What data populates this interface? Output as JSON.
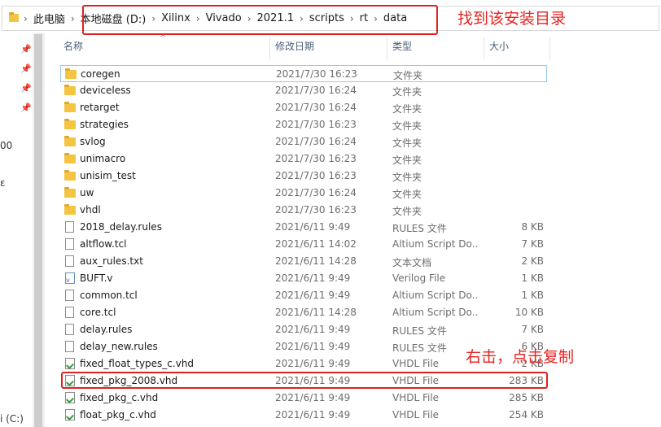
{
  "breadcrumb": [
    "此电脑",
    "本地磁盘 (D:)",
    "Xilinx",
    "Vivado",
    "2021.1",
    "scripts",
    "rt",
    "data"
  ],
  "annotations": {
    "top": "找到该安装目录",
    "row": "右击，点击复制"
  },
  "sidebar_edge": {
    "a": "00",
    "b": "ε",
    "c": "i (C:)"
  },
  "columns": {
    "name": "名称",
    "date": "修改日期",
    "type": "类型",
    "size": "大小"
  },
  "files": [
    {
      "name": "coregen",
      "date": "2021/7/30 16:23",
      "type": "文件夹",
      "size": "",
      "icon": "folder"
    },
    {
      "name": "deviceless",
      "date": "2021/7/30 16:24",
      "type": "文件夹",
      "size": "",
      "icon": "folder"
    },
    {
      "name": "retarget",
      "date": "2021/7/30 16:24",
      "type": "文件夹",
      "size": "",
      "icon": "folder"
    },
    {
      "name": "strategies",
      "date": "2021/7/30 16:23",
      "type": "文件夹",
      "size": "",
      "icon": "folder"
    },
    {
      "name": "svlog",
      "date": "2021/7/30 16:24",
      "type": "文件夹",
      "size": "",
      "icon": "folder"
    },
    {
      "name": "unimacro",
      "date": "2021/7/30 16:23",
      "type": "文件夹",
      "size": "",
      "icon": "folder"
    },
    {
      "name": "unisim_test",
      "date": "2021/7/30 16:23",
      "type": "文件夹",
      "size": "",
      "icon": "folder"
    },
    {
      "name": "uw",
      "date": "2021/7/30 16:24",
      "type": "文件夹",
      "size": "",
      "icon": "folder"
    },
    {
      "name": "vhdl",
      "date": "2021/7/30 16:23",
      "type": "文件夹",
      "size": "",
      "icon": "folder"
    },
    {
      "name": "2018_delay.rules",
      "date": "2021/6/11 9:49",
      "type": "RULES 文件",
      "size": "8 KB",
      "icon": "doc"
    },
    {
      "name": "altflow.tcl",
      "date": "2021/6/11 14:02",
      "type": "Altium Script Do...",
      "size": "7 KB",
      "icon": "doc"
    },
    {
      "name": "aux_rules.txt",
      "date": "2021/6/11 14:28",
      "type": "文本文档",
      "size": "2 KB",
      "icon": "doc"
    },
    {
      "name": "BUFT.v",
      "date": "2021/6/11 9:49",
      "type": "Verilog File",
      "size": "1 KB",
      "icon": "verilog"
    },
    {
      "name": "common.tcl",
      "date": "2021/6/11 9:49",
      "type": "Altium Script Do...",
      "size": "1 KB",
      "icon": "doc"
    },
    {
      "name": "core.tcl",
      "date": "2021/6/11 14:28",
      "type": "Altium Script Do...",
      "size": "10 KB",
      "icon": "doc"
    },
    {
      "name": "delay.rules",
      "date": "2021/6/11 9:49",
      "type": "RULES 文件",
      "size": "7 KB",
      "icon": "doc"
    },
    {
      "name": "delay_new.rules",
      "date": "2021/6/11 9:49",
      "type": "RULES 文件",
      "size": "6 KB",
      "icon": "doc"
    },
    {
      "name": "fixed_float_types_c.vhd",
      "date": "2021/6/11 9:49",
      "type": "VHDL File",
      "size": "2 KB",
      "icon": "vhdl"
    },
    {
      "name": "fixed_pkg_2008.vhd",
      "date": "2021/6/11 9:49",
      "type": "VHDL File",
      "size": "283 KB",
      "icon": "vhdl"
    },
    {
      "name": "fixed_pkg_c.vhd",
      "date": "2021/6/11 9:49",
      "type": "VHDL File",
      "size": "285 KB",
      "icon": "vhdl"
    },
    {
      "name": "float_pkg_c.vhd",
      "date": "2021/6/11 9:49",
      "type": "VHDL File",
      "size": "254 KB",
      "icon": "vhdl"
    }
  ],
  "colors": {
    "highlight": "#e02020",
    "annotation": "#e8231e",
    "folder": "#f4c542"
  }
}
